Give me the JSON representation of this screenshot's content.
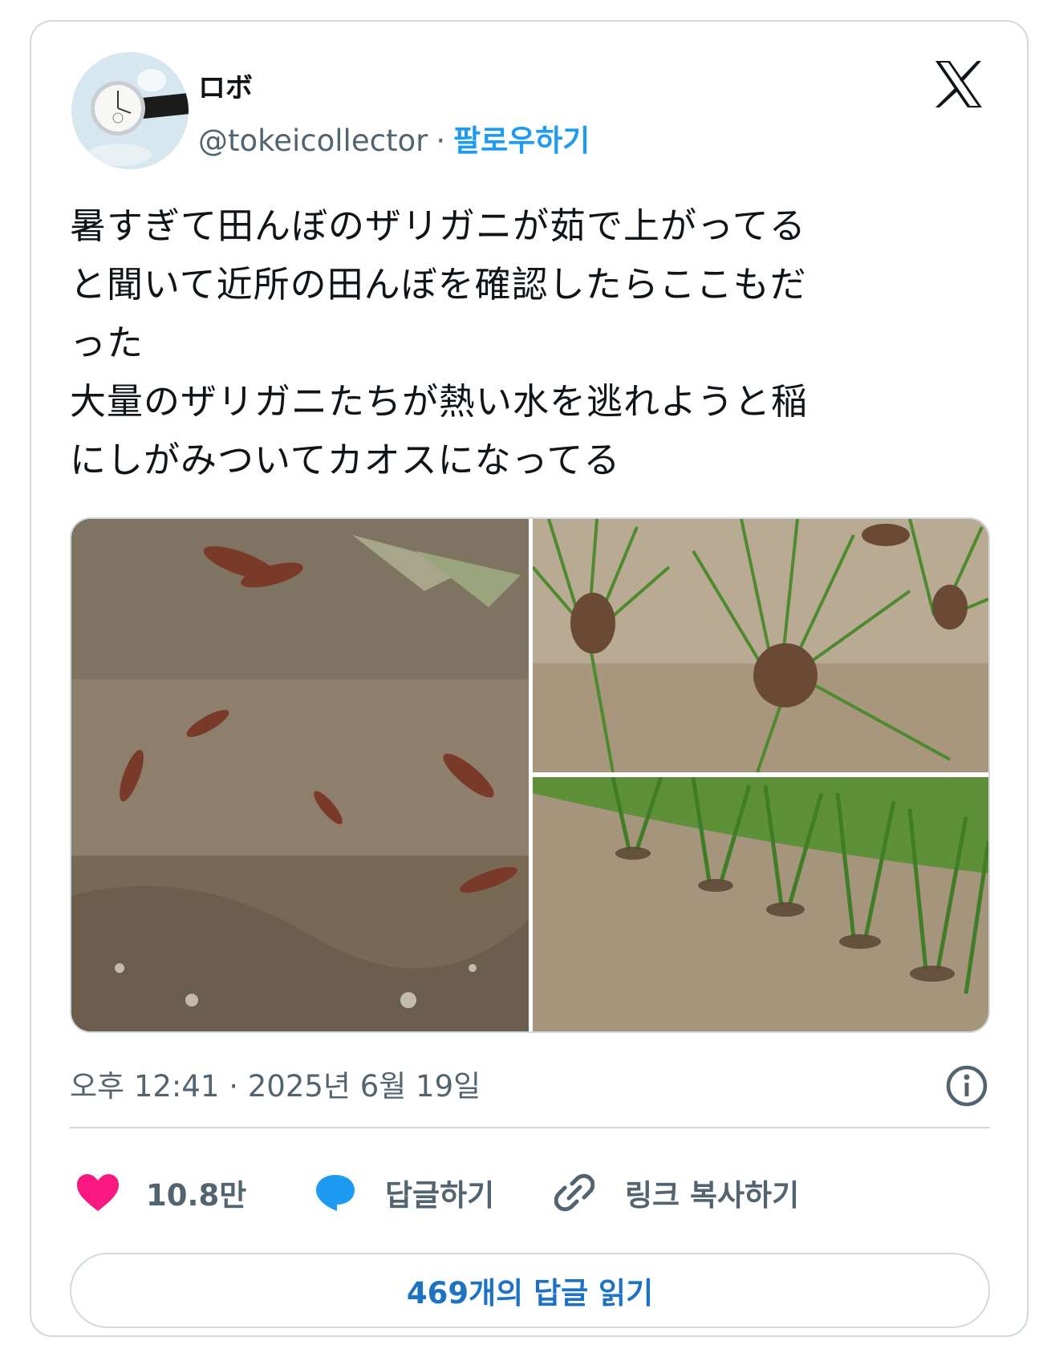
{
  "author": {
    "display_name": "ロボ",
    "handle": "@tokeicollector",
    "separator": "·",
    "follow_label": "팔로우하기",
    "avatar_icon": "wristwatch-avatar"
  },
  "brand_icon": "x-logo-icon",
  "tweet": {
    "text": "暑すぎて田んぼのザリガニが茹で上がってる\nと聞いて近所の田んぼを確認したらここもだ\nった\n大量のザリガニたちが熱い水を逃れようと稲\nにしがみついてカオスになってる",
    "timestamp": "오후 12:41 · 2025년 6월 19일"
  },
  "media": [
    {
      "name": "crayfish-in-muddy-water-photo"
    },
    {
      "name": "crayfish-clinging-to-rice-plants-photo"
    },
    {
      "name": "rice-paddy-rows-photo"
    }
  ],
  "actions": {
    "likes": "10.8만",
    "reply_label": "답글하기",
    "copy_link_label": "링크 복사하기"
  },
  "read_replies_label": "469개의 답글 읽기",
  "colors": {
    "accent": "#1d9bf0",
    "like": "#f91880",
    "border": "#cfd9de",
    "secondary_text": "#536471"
  }
}
